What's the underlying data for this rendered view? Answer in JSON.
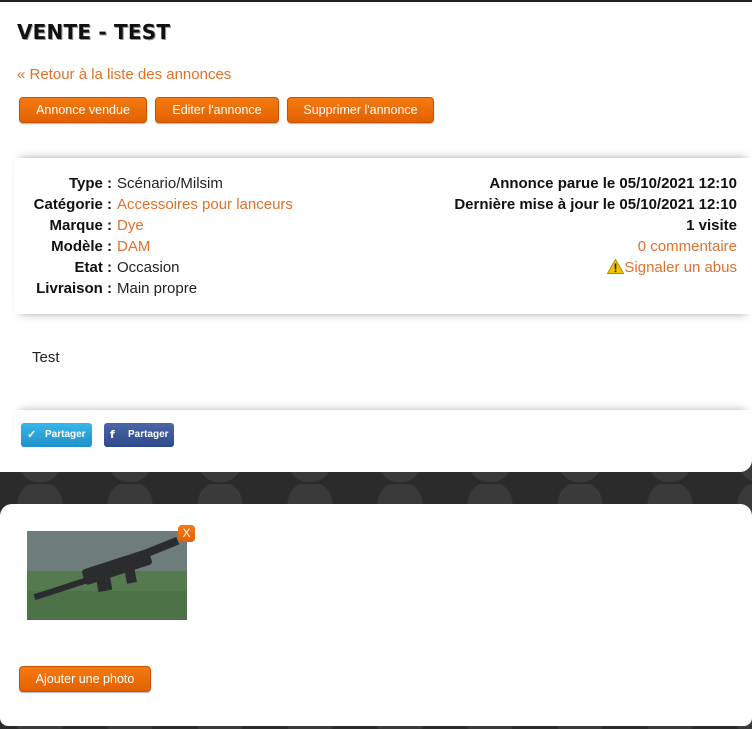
{
  "page": {
    "title": "VENTE - TEST",
    "back_link": "« Retour à la liste des annonces"
  },
  "actions": {
    "sold": "Annonce vendue",
    "edit": "Editer l'annonce",
    "delete": "Supprimer l'annonce"
  },
  "details": [
    {
      "label": "Type :",
      "value": "Scénario/Milsim",
      "link": false
    },
    {
      "label": "Catégorie :",
      "value": "Accessoires pour lanceurs",
      "link": true
    },
    {
      "label": "Marque :",
      "value": "Dye",
      "link": true
    },
    {
      "label": "Modèle :",
      "value": "DAM",
      "link": true
    },
    {
      "label": "Etat :",
      "value": "Occasion",
      "link": false
    },
    {
      "label": "Livraison :",
      "value": "Main propre",
      "link": false
    }
  ],
  "meta": {
    "published": "Annonce parue le 05/10/2021 12:10",
    "updated": "Dernière mise à jour le 05/10/2021 12:10",
    "visits": "1 visite",
    "comments": "0 commentaire",
    "report": "Signaler un abus"
  },
  "description": "Test",
  "share": {
    "twitter": "Partager",
    "facebook": "Partager"
  },
  "photos": {
    "remove_label": "X",
    "add_button": "Ajouter une photo"
  },
  "colors": {
    "accent": "#e0712a",
    "button": "#f06c00",
    "twitter": "#29a3dc",
    "facebook": "#3b5998"
  },
  "icons": {
    "report": "warning-icon",
    "twitter": "twitter-icon",
    "facebook": "facebook-icon"
  }
}
